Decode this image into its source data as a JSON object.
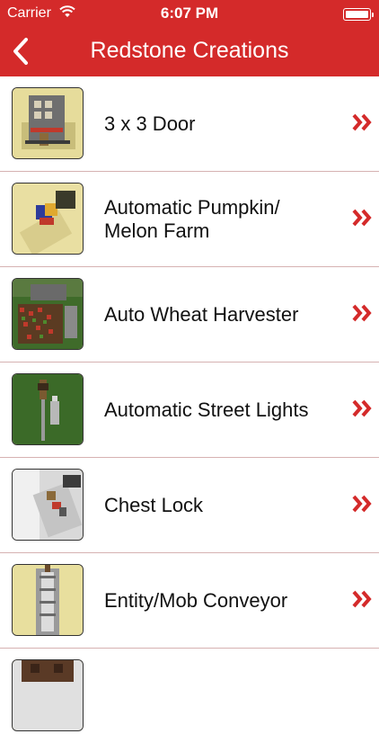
{
  "status_bar": {
    "carrier": "Carrier",
    "time": "6:07 PM",
    "wifi_icon": "wifi-icon",
    "battery_level": 1.0
  },
  "nav_bar": {
    "title": "Redstone Creations",
    "back_icon": "chevron-left-icon"
  },
  "colors": {
    "brand_red": "#d42a2a",
    "chevron_red": "#d42a2a",
    "separator": "#d6b2b2"
  },
  "items": [
    {
      "label": "3 x 3 Door",
      "thumbnail": "3x3-door-thumbnail"
    },
    {
      "label": "Automatic Pumpkin/\nMelon Farm",
      "thumbnail": "pumpkin-melon-farm-thumbnail"
    },
    {
      "label": "Auto Wheat Harvester",
      "thumbnail": "wheat-harvester-thumbnail"
    },
    {
      "label": "Automatic Street Lights",
      "thumbnail": "street-lights-thumbnail"
    },
    {
      "label": "Chest Lock",
      "thumbnail": "chest-lock-thumbnail"
    },
    {
      "label": "Entity/Mob Conveyor",
      "thumbnail": "mob-conveyor-thumbnail"
    },
    {
      "label": "",
      "thumbnail": "partial-item-thumbnail"
    }
  ],
  "row_icon": "double-chevron-right-icon"
}
